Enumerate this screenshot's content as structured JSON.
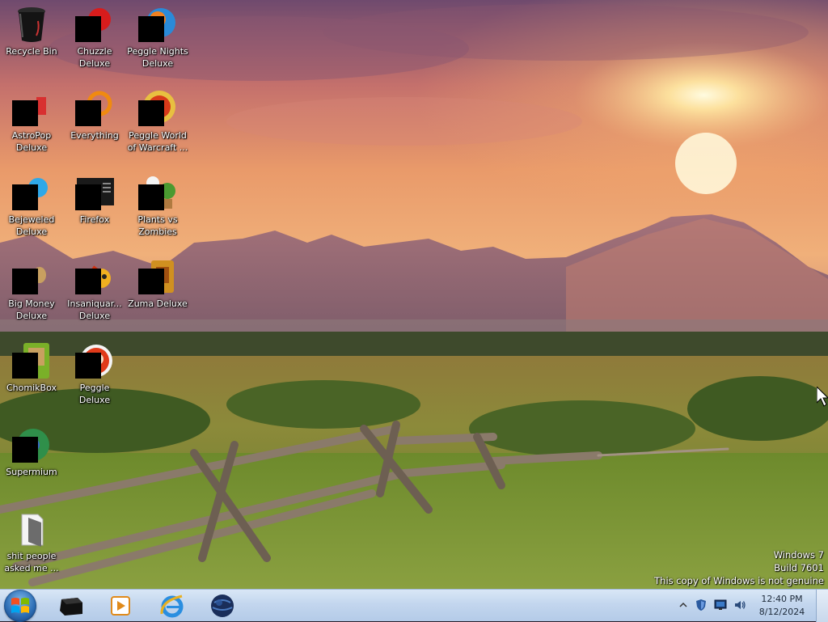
{
  "desktop": {
    "icons": [
      {
        "label": "Recycle Bin",
        "icon": "recycle-bin-icon"
      },
      {
        "label": "Chuzzle\nDeluxe",
        "icon": "chuzzle-icon"
      },
      {
        "label": "Peggle Nights\nDeluxe",
        "icon": "peggle-nights-icon"
      },
      {
        "label": "AstroPop\nDeluxe",
        "icon": "astropop-icon"
      },
      {
        "label": "Everything",
        "icon": "everything-icon"
      },
      {
        "label": "Peggle World\nof Warcraft ...",
        "icon": "peggle-wow-icon"
      },
      {
        "label": "Bejeweled\nDeluxe",
        "icon": "bejeweled-icon"
      },
      {
        "label": "Firefox",
        "icon": "firefox-icon"
      },
      {
        "label": "Plants vs\nZombies",
        "icon": "plants-vs-zombies-icon"
      },
      {
        "label": "Big Money\nDeluxe",
        "icon": "big-money-icon"
      },
      {
        "label": "Insaniquar...\nDeluxe",
        "icon": "insaniquarium-icon"
      },
      {
        "label": "Zuma Deluxe",
        "icon": "zuma-icon"
      },
      {
        "label": "ChomikBox",
        "icon": "chomikbox-icon"
      },
      {
        "label": "Peggle Deluxe",
        "icon": "peggle-icon"
      },
      {
        "label": "Supermium",
        "icon": "supermium-icon"
      },
      {
        "label": "shit people\nasked me ...",
        "icon": "folder-icon"
      }
    ]
  },
  "watermark": {
    "line1": "Windows 7",
    "line2": "Build 7601",
    "line3": "This copy of Windows is not genuine"
  },
  "taskbar": {
    "pinned": [
      {
        "icon": "black-app-icon"
      },
      {
        "icon": "media-player-icon"
      },
      {
        "icon": "internet-explorer-icon"
      },
      {
        "icon": "globe-browser-icon"
      }
    ],
    "tray": {
      "time": "12:40 PM",
      "date": "8/12/2024"
    }
  },
  "colors": {
    "taskbar": "#c3d6ee",
    "label_text": "#ffffff",
    "clock_text": "#1d2a3a"
  }
}
